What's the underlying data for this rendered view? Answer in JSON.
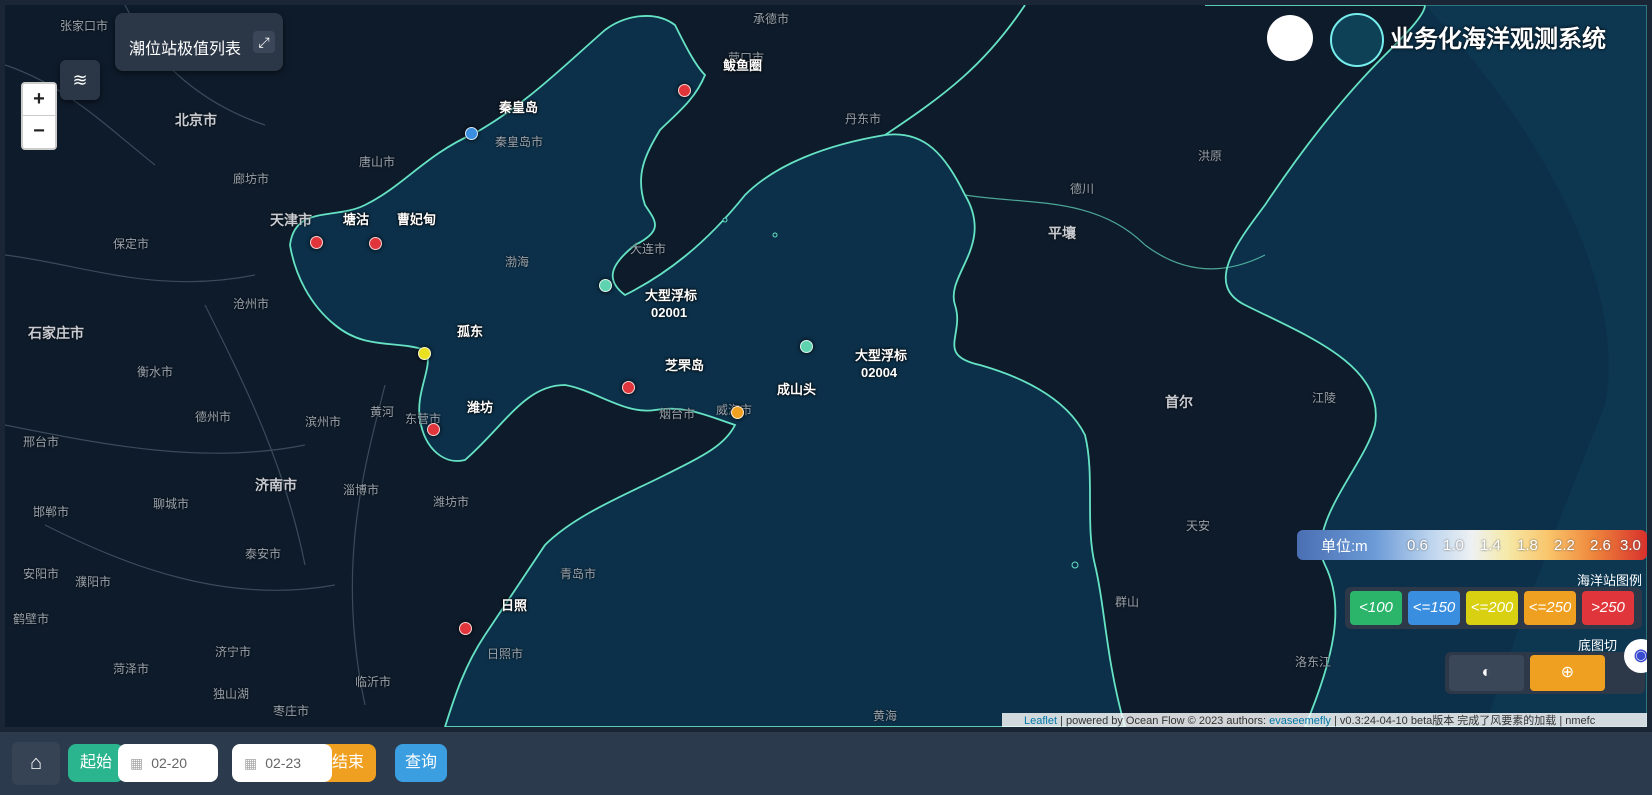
{
  "map": {
    "panel_button": "潮位站极值列表",
    "zoom_in": "+",
    "zoom_out": "−",
    "cities": [
      {
        "name": "张家口市"
      },
      {
        "name": "北京市"
      },
      {
        "name": "廊坊市"
      },
      {
        "name": "天津市"
      },
      {
        "name": "保定市"
      },
      {
        "name": "沧州市"
      },
      {
        "name": "石家庄市"
      },
      {
        "name": "衡水市"
      },
      {
        "name": "德州市"
      },
      {
        "name": "邢台市"
      },
      {
        "name": "济南市"
      },
      {
        "name": "聊城市"
      },
      {
        "name": "邯郸市"
      },
      {
        "name": "泰安市"
      },
      {
        "name": "安阳市"
      },
      {
        "name": "濮阳市"
      },
      {
        "name": "鹤壁市"
      },
      {
        "name": "济宁市"
      },
      {
        "name": "菏泽市"
      },
      {
        "name": "临沂市"
      },
      {
        "name": "独山湖"
      },
      {
        "name": "枣庄市"
      },
      {
        "name": "淄博市"
      },
      {
        "name": "潍坊市"
      },
      {
        "name": "滨州市"
      },
      {
        "name": "东营市"
      },
      {
        "name": "黄河"
      },
      {
        "name": "唐山市"
      },
      {
        "name": "秦皇岛市"
      },
      {
        "name": "渤海"
      },
      {
        "name": "大连市"
      },
      {
        "name": "烟台市"
      },
      {
        "name": "威海市"
      },
      {
        "name": "青岛市"
      },
      {
        "name": "日照市"
      },
      {
        "name": "丹东市"
      },
      {
        "name": "平壤"
      },
      {
        "name": "首尔"
      },
      {
        "name": "德川"
      },
      {
        "name": "洪原"
      },
      {
        "name": "江陵"
      },
      {
        "name": "天安"
      },
      {
        "name": "群山"
      },
      {
        "name": "洛东江"
      },
      {
        "name": "黄海"
      },
      {
        "name": "承德市"
      },
      {
        "name": "营口市"
      }
    ],
    "stations": [
      {
        "name": "秦皇岛",
        "color": "#3a8ee0"
      },
      {
        "name": "鲅鱼圈",
        "color": "#e0353a"
      },
      {
        "name": "塘沽",
        "color": "#e0353a"
      },
      {
        "name": "曹妃甸",
        "color": "#e0353a"
      },
      {
        "name": "大型浮标",
        "code": "02001",
        "color": "#5fd3b0"
      },
      {
        "name": "孤东",
        "color": "#e8e020"
      },
      {
        "name": "芝罘岛",
        "color": "#e0353a"
      },
      {
        "name": "潍坊",
        "color": "#e0353a"
      },
      {
        "name": "成山头",
        "color": "#f0a020"
      },
      {
        "name": "大型浮标",
        "code": "02004",
        "color": "#5fd3b0"
      },
      {
        "name": "日照",
        "color": "#e0353a"
      }
    ]
  },
  "header": {
    "title": "业务化海洋观测系统"
  },
  "scale": {
    "unit": "单位:m",
    "ticks": [
      "0.6",
      "1.0",
      "1.4",
      "1.8",
      "2.2",
      "2.6",
      "3.0"
    ]
  },
  "legend": {
    "title": "海洋站图例",
    "items": [
      {
        "label": "<100",
        "color": "#2ab56b"
      },
      {
        "label": "<=150",
        "color": "#3a8ee0"
      },
      {
        "label": "<=200",
        "color": "#d8d010"
      },
      {
        "label": "<=250",
        "color": "#f0a020"
      },
      {
        "label": ">250",
        "color": "#e0353a"
      }
    ]
  },
  "basemap": {
    "title": "底图切"
  },
  "attribution": {
    "leaflet": "Leaflet",
    "text1": " | powered by Ocean Flow © 2023 authors: ",
    "author": "evaseemefly",
    "text2": " | v0.3:24-04-10 beta版本 完成了风要素的加载 | nmefc"
  },
  "toolbar": {
    "start_label": "起始",
    "start_date": "02-20",
    "end_date": "02-23",
    "end_label": "结束",
    "query_label": "查询"
  }
}
